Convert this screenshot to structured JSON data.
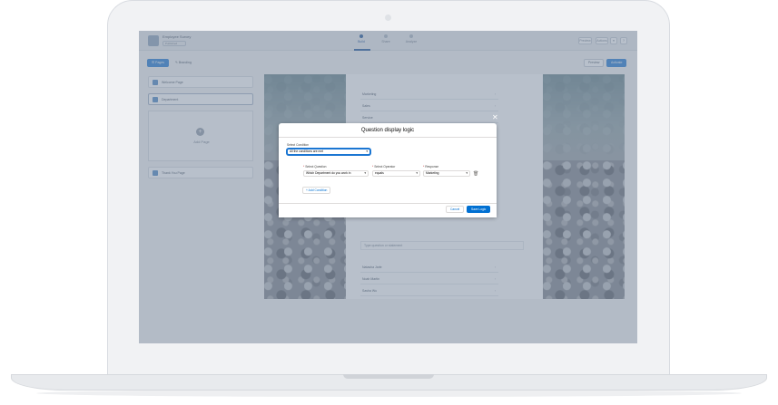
{
  "app": {
    "title": "Employee Survey",
    "status": "Published"
  },
  "nav": {
    "tabs": [
      {
        "label": "Build"
      },
      {
        "label": "Share"
      },
      {
        "label": "Analyze"
      }
    ]
  },
  "header_actions": {
    "preview": "Preview",
    "more": "Actions"
  },
  "toolbar": {
    "pages_label": "Pages",
    "branding_label": "Branding",
    "preview_label": "Preview",
    "activate_label": "Activate"
  },
  "pages": [
    {
      "label": "Welcome Page"
    },
    {
      "label": "Department"
    },
    {
      "label": "Thank You Page"
    }
  ],
  "add_page_label": "Add Page",
  "survey": {
    "options_top": [
      "Marketing",
      "Sales",
      "Service"
    ],
    "options_bottom": [
      "Natasha Jarle",
      "Noah Martin",
      "Sasha Wu"
    ],
    "question_placeholder": "Type question or statement"
  },
  "modal": {
    "title": "Question display logic",
    "close_icon": "close-icon",
    "select_condition_label": "Select Condition",
    "select_condition_value": "All the conditions are met",
    "select_question_label": "Select Question",
    "select_question_value": "Which Department do you work in",
    "select_operator_label": "Select Operator",
    "select_operator_value": "equals",
    "response_label": "Response",
    "response_value": "Marketing",
    "add_condition_label": "Add Condition",
    "cancel_label": "Cancel",
    "save_label": "Save Logic"
  },
  "colors": {
    "brand": "#0070d2",
    "overlay": "#7e8ca0",
    "required": "#c23934"
  }
}
